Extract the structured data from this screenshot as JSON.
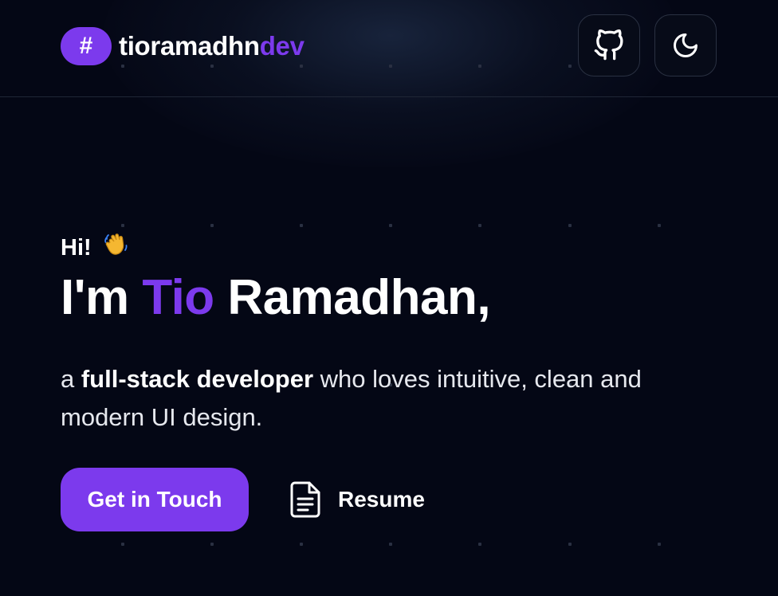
{
  "header": {
    "logo_symbol": "#",
    "logo_name": "tioramadhn",
    "logo_suffix": "dev",
    "github_icon": "github-icon",
    "theme_icon": "moon-icon"
  },
  "hero": {
    "greeting": "Hi!",
    "greeting_emoji": "waving-hand-icon",
    "headline_prefix": "I'm ",
    "headline_highlight": "Tio",
    "headline_suffix": " Ramadhan,",
    "tagline_start": "a ",
    "tagline_bold": "full-stack developer",
    "tagline_end": " who loves intuitive, clean and modern UI design."
  },
  "actions": {
    "primary_label": "Get in Touch",
    "secondary_label": "Resume",
    "secondary_icon": "document-icon"
  },
  "colors": {
    "background": "#040715",
    "accent": "#7c3aed",
    "text": "#ffffff"
  }
}
